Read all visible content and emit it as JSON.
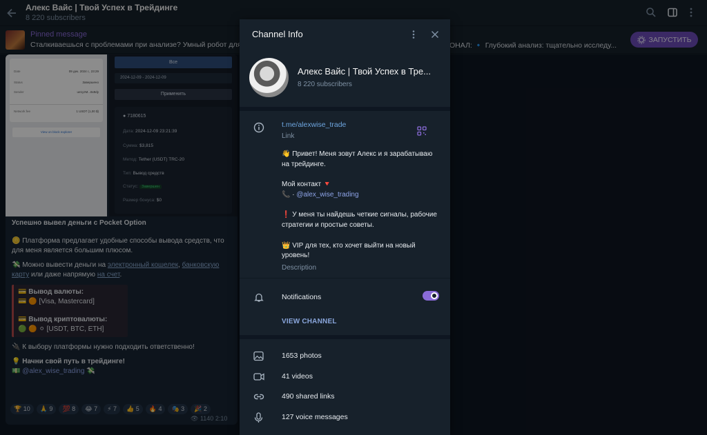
{
  "header": {
    "title": "Алекс Вайс | Твой Успех в Трейдинге",
    "subscribers": "8 220 subscribers"
  },
  "pinned": {
    "title": "Pinned message",
    "text": "Сталкиваешься с проблемами при анализе? Умный робот для",
    "text_tail": "ОНАЛ:  🔹 Глубокий анализ: тщательно исследу...",
    "button_label": "ЗАПУСТИТЬ"
  },
  "message": {
    "receipt_left": [
      {
        "k": "Date",
        "v": "09 дек. 2024 г., 23:29"
      },
      {
        "k": "Status",
        "v": "Завершено"
      },
      {
        "k": "Sender",
        "v": "ue1yzM...8x9dy"
      },
      {
        "k": "Network fee",
        "v": "1 USDT (1,00 $)"
      }
    ],
    "receipt_left_button": "View on block explorer",
    "receipt_right": {
      "filter_all": "Все",
      "date_range": "2024-12-09 - 2024-12-09",
      "apply": "Применить",
      "id": "7180615",
      "date_label": "Дата:",
      "date_value": "2024-12-09 23:21:39",
      "sum_label": "Сумма:",
      "sum_value": "$3,815",
      "method_label": "Метод:",
      "method_value": "Tether (USDT) TRC-20",
      "type_label": "Тип:",
      "type_value": "Вывод средств",
      "status_label": "Статус:",
      "status_value": "Завершен",
      "bonus_label": "Размер бонуса:",
      "bonus_value": "$0"
    },
    "headline": "Успешно вывел деньги с Pocket Option",
    "p1": "🪙 Платформа предлагает удобные способы вывода средств, что для меня является большим плюсом.",
    "p2_prefix": "💸 Можно вывести деньги на ",
    "p2_link1": "электронный кошелек",
    "p2_sep": ", ",
    "p2_link2": "банковскую карту",
    "p2_mid": " или даже напрямую ",
    "p2_link3": "на счет",
    "p2_end": ".",
    "q1_title": "💳 Вывод валюты:",
    "q1_body": "💳 🟠 [Visa, Mastercard]",
    "q2_title": "💳 Вывод криптовалюты:",
    "q2_body": "🟢 🟠 ⚪ [USDT, BTC, ETH]",
    "p3": "🔌 К выбору платформы нужно подходить ответственно!",
    "p4": "💡 Начни свой путь в трейдинге!",
    "p5": "💵 @alex_wise_trading 💸",
    "reactions": [
      "🏆 10",
      "🙏 9",
      "💯 8",
      "😂 7",
      "⚡ 7",
      "👍 5",
      "🔥 4",
      "🎭 3",
      "🎉 2"
    ],
    "views": "1140",
    "time": "2:10"
  },
  "panel": {
    "title": "Channel Info",
    "name": "Алекс Вайс | Твой Успех в Тре...",
    "subscribers": "8 220 subscribers",
    "link": "t.me/alexwise_trade",
    "link_label": "Link",
    "desc1": "👋 Привет! Меня зовут Алекс и я зарабатываю на трейдинге.",
    "desc2": "Мой контакт 🔻",
    "desc3_prefix": "📞 · ",
    "desc3_handle": "@alex_wise_trading",
    "desc4": "❗ У меня ты найдешь четкие сигналы, рабочие стратегии и простые советы.",
    "desc5": "👑 VIP для тех, кто хочет выйти на новый уровень!",
    "desc_label": "Description",
    "notifications": "Notifications",
    "notifications_on": true,
    "view_channel": "VIEW CHANNEL",
    "media": [
      {
        "icon": "photo-icon",
        "label": "1653 photos"
      },
      {
        "icon": "video-icon",
        "label": "41 videos"
      },
      {
        "icon": "link-icon",
        "label": "490 shared links"
      },
      {
        "icon": "mic-icon",
        "label": "127 voice messages"
      }
    ]
  },
  "colors": {
    "accent": "#8a6bd8",
    "link": "#6ea6e0",
    "panel_bg": "#17212b",
    "chat_bg": "#0e1621"
  }
}
